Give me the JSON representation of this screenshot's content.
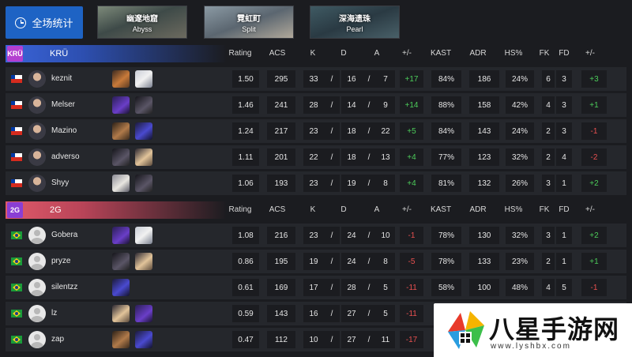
{
  "top_bar": {
    "overall_label": "全场统计",
    "maps": [
      {
        "cn": "幽邃地窟",
        "en": "Abyss"
      },
      {
        "cn": "霓虹町",
        "en": "Split"
      },
      {
        "cn": "深海遗珠",
        "en": "Pearl"
      }
    ]
  },
  "columns": [
    "Rating",
    "ACS",
    "K",
    "D",
    "A",
    "+/-",
    "KAST",
    "ADR",
    "HS%",
    "FK",
    "FD",
    "+/-"
  ],
  "teams": [
    {
      "name": "KRÜ",
      "logo_text": "KRÜ",
      "players": [
        {
          "name": "keznit",
          "flag": "chile",
          "avatar": "photo",
          "agents": [
            "agent-orange",
            "agent-white"
          ],
          "rating": "1.50",
          "acs": "295",
          "k": "33",
          "d": "16",
          "a": "7",
          "pm": "+17",
          "kast": "84%",
          "adr": "186",
          "hs": "24%",
          "fk": "6",
          "fd": "3",
          "fpm": "+3"
        },
        {
          "name": "Melser",
          "flag": "chile",
          "avatar": "photo",
          "agents": [
            "agent-purple",
            "agent-dark"
          ],
          "rating": "1.46",
          "acs": "241",
          "k": "28",
          "d": "14",
          "a": "9",
          "pm": "+14",
          "kast": "88%",
          "adr": "158",
          "hs": "42%",
          "fk": "4",
          "fd": "3",
          "fpm": "+1"
        },
        {
          "name": "Mazino",
          "flag": "chile",
          "avatar": "photo",
          "agents": [
            "agent-brown",
            "agent-violet"
          ],
          "rating": "1.24",
          "acs": "217",
          "k": "23",
          "d": "18",
          "a": "22",
          "pm": "+5",
          "kast": "84%",
          "adr": "143",
          "hs": "24%",
          "fk": "2",
          "fd": "3",
          "fpm": "-1"
        },
        {
          "name": "adverso",
          "flag": "chile",
          "avatar": "photo",
          "agents": [
            "agent-dark",
            "agent-blonde"
          ],
          "rating": "1.11",
          "acs": "201",
          "k": "22",
          "d": "18",
          "a": "13",
          "pm": "+4",
          "kast": "77%",
          "adr": "123",
          "hs": "32%",
          "fk": "2",
          "fd": "4",
          "fpm": "-2"
        },
        {
          "name": "Shyy",
          "flag": "chile",
          "avatar": "photo",
          "agents": [
            "agent-hat",
            "agent-dark"
          ],
          "rating": "1.06",
          "acs": "193",
          "k": "23",
          "d": "19",
          "a": "8",
          "pm": "+4",
          "kast": "81%",
          "adr": "132",
          "hs": "26%",
          "fk": "3",
          "fd": "1",
          "fpm": "+2"
        }
      ]
    },
    {
      "name": "2G",
      "logo_text": "2G",
      "players": [
        {
          "name": "Gobera",
          "flag": "brazil",
          "avatar": "blank",
          "agents": [
            "agent-purple",
            "agent-white"
          ],
          "rating": "1.08",
          "acs": "216",
          "k": "23",
          "d": "24",
          "a": "10",
          "pm": "-1",
          "kast": "78%",
          "adr": "130",
          "hs": "32%",
          "fk": "3",
          "fd": "1",
          "fpm": "+2"
        },
        {
          "name": "pryze",
          "flag": "brazil",
          "avatar": "blank",
          "agents": [
            "agent-dark",
            "agent-blonde"
          ],
          "rating": "0.86",
          "acs": "195",
          "k": "19",
          "d": "24",
          "a": "8",
          "pm": "-5",
          "kast": "78%",
          "adr": "133",
          "hs": "23%",
          "fk": "2",
          "fd": "1",
          "fpm": "+1"
        },
        {
          "name": "silentzz",
          "flag": "brazil",
          "avatar": "blank",
          "agents": [
            "agent-violet"
          ],
          "rating": "0.61",
          "acs": "169",
          "k": "17",
          "d": "28",
          "a": "5",
          "pm": "-11",
          "kast": "58%",
          "adr": "100",
          "hs": "48%",
          "fk": "4",
          "fd": "5",
          "fpm": "-1"
        },
        {
          "name": "lz",
          "flag": "brazil",
          "avatar": "blank",
          "agents": [
            "agent-blonde",
            "agent-purple"
          ],
          "rating": "0.59",
          "acs": "143",
          "k": "16",
          "d": "27",
          "a": "5",
          "pm": "-11",
          "kast": "",
          "adr": "",
          "hs": "",
          "fk": "",
          "fd": "",
          "fpm": ""
        },
        {
          "name": "zap",
          "flag": "brazil",
          "avatar": "blank",
          "agents": [
            "agent-brown",
            "agent-violet"
          ],
          "rating": "0.47",
          "acs": "112",
          "k": "10",
          "d": "27",
          "a": "11",
          "pm": "-17",
          "kast": "",
          "adr": "",
          "hs": "",
          "fk": "",
          "fd": "",
          "fpm": ""
        }
      ]
    }
  ],
  "watermark": {
    "title": "八星手游网",
    "url": "www.lyshbx.com"
  },
  "colors": {
    "positive": "#4ccc5a",
    "negative": "#e85050",
    "accent": "#1e63c4"
  }
}
